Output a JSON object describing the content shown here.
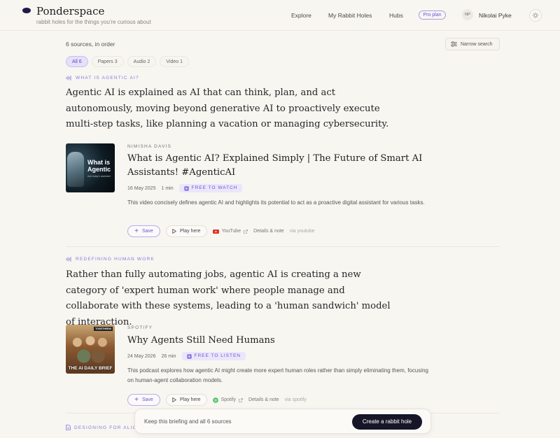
{
  "app": {
    "name": "Ponderspace",
    "tagline": "rabbit holes for the things you're curious about"
  },
  "nav": {
    "explore": "Explore",
    "my_rabbit_holes": "My Rabbit Holes",
    "hubs": "Hubs",
    "pro_badge": "Pro plan",
    "user_initials": "NP",
    "user_name": "Nikolai Pyke"
  },
  "toolbar": {
    "sources_count": "6 sources, in order",
    "narrow_search": "Narrow search",
    "tabs": [
      {
        "label": "All 6",
        "active": true
      },
      {
        "label": "Papers 3",
        "active": false
      },
      {
        "label": "Audio 2",
        "active": false
      },
      {
        "label": "Video 1",
        "active": false
      }
    ]
  },
  "sections": [
    {
      "label": "WHAT IS AGENTIC AI?",
      "icon": "audio-wave-icon",
      "claim": "Agentic AI is explained as AI that can think, plan, and act autonomously, moving beyond generative AI to proactively execute multi-step tasks, like planning a vacation or managing cybersecurity.",
      "source": {
        "author": "NIMISHA DAVIS",
        "title": "What is Agentic AI? Explained Simply | The Future of Smart AI Assistants! #AgenticAI",
        "date": "16 May 2025",
        "duration": "1 min",
        "badge": "FREE TO WATCH",
        "description": "This video concisely defines agentic AI and highlights its potential to act as a proactive digital assistant for various tasks.",
        "thumb_title": "What is Agentic",
        "thumb_sub": "Ask today's assistant",
        "save": "Save",
        "play": "Play here",
        "platform": "YouTube",
        "details": "Details & note",
        "via": "via youtube"
      }
    },
    {
      "label": "REDEFINING HUMAN WORK",
      "icon": "audio-wave-icon",
      "claim": "Rather than fully automating jobs, agentic AI is creating a new category of 'expert human work' where people manage and collaborate with these systems, leading to a 'human sandwich' model of interaction.",
      "source": {
        "author": "SPOTIFY",
        "title": "Why Agents Still Need Humans",
        "date": "24 May 2026",
        "duration": "26 min",
        "badge": "FREE TO LISTEN",
        "description": "This podcast explores how agentic AI might create more expert human roles rather than simply eliminating them, focusing on human-agent collaboration models.",
        "thumb_title": "THE AI DAILY BRIEF",
        "thumb_brand": "TOGETHERAI",
        "save": "Save",
        "play": "Play here",
        "platform": "Spotify",
        "details": "Details & note",
        "via": "via spotify"
      }
    },
    {
      "label": "DESIGNING FOR ALIG",
      "icon": "document-icon"
    }
  ],
  "bottom_bar": {
    "text": "Keep this briefing and all 6 sources",
    "button": "Create a rabbit hole"
  },
  "colors": {
    "accent": "#6a55d6",
    "background": "#f8f6f1",
    "dark_button": "#161628",
    "youtube": "#e0322a",
    "spotify": "#3fbf5a"
  }
}
